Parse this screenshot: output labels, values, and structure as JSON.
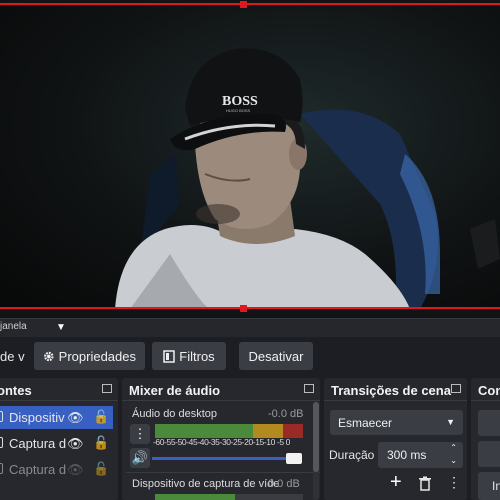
{
  "preview": {
    "description_icon": "webcam-feed"
  },
  "bottombar": {
    "window_label": "janela",
    "dropdown_icon": "▼"
  },
  "toolbar": {
    "scene_label_fragment": "de v",
    "properties_label": "Propriedades",
    "filters_label": "Filtros",
    "deactivate_label": "Desativar"
  },
  "sources": {
    "title": "ontes",
    "items": [
      {
        "label": "Dispositiv",
        "selected": true
      },
      {
        "label": "Captura d",
        "selected": false
      },
      {
        "label": "Captura d",
        "selected": false
      }
    ]
  },
  "mixer": {
    "title": "Mixer de áudio",
    "channels": [
      {
        "name": "Áudio do desktop",
        "db": "-0.0 dB"
      },
      {
        "name": "Dispositivo de captura de víde",
        "db": "0.0 dB"
      }
    ],
    "ticks": "-60-55-50-45-40-35-30-25-20-15-10 -5  0",
    "volume_level": 1.0
  },
  "transitions": {
    "title": "Transições de cena",
    "transition_value": "Esmaecer",
    "duration_label": "Duração",
    "duration_value": "300 ms"
  },
  "controls": {
    "title": "Con",
    "button_fragment": "In"
  }
}
